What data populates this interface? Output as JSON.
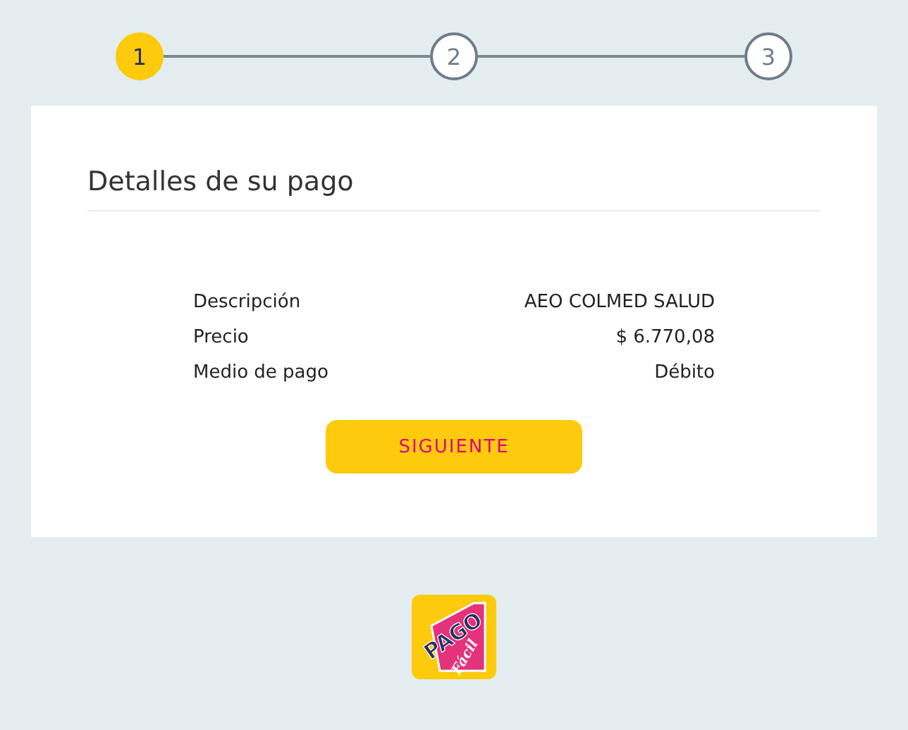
{
  "steps": [
    {
      "label": "1",
      "selected": true
    },
    {
      "label": "2",
      "selected": false
    },
    {
      "label": "3",
      "selected": false
    }
  ],
  "card": {
    "title": "Detalles de su pago",
    "details": [
      {
        "label": "Descripción",
        "value": "AEO COLMED SALUD"
      },
      {
        "label": "Precio",
        "value": "$ 6.770,08"
      },
      {
        "label": "Medio de pago",
        "value": "Débito"
      }
    ],
    "button": "SIGUIENTE"
  },
  "logo": {
    "line_1": "PAGO",
    "line_2": "Fácil"
  }
}
